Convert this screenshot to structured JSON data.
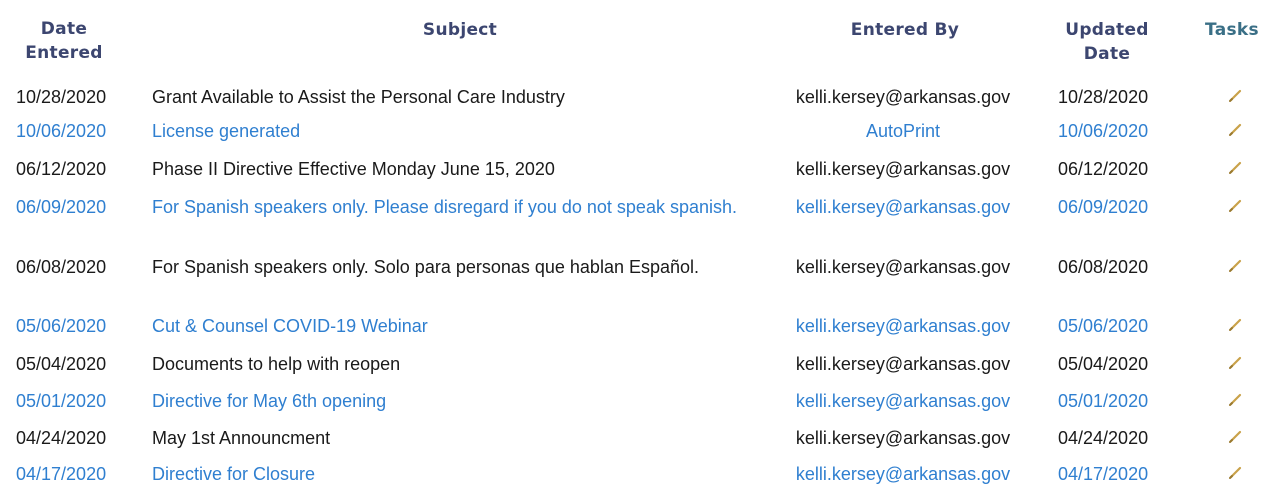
{
  "headers": {
    "date_entered_line1": "Date",
    "date_entered_line2": "Entered",
    "subject": "Subject",
    "entered_by": "Entered By",
    "updated_date_line1": "Updated",
    "updated_date_line2": "Date",
    "tasks": "Tasks"
  },
  "colors": {
    "header": "#3c4670",
    "link": "#2f7fd0",
    "text": "#1a1a1a",
    "task_icon": "#c9a24a"
  },
  "rows": [
    {
      "date_entered": "10/28/2020",
      "subject": "Grant Available to Assist the Personal Care Industry",
      "entered_by": "kelli.kersey@arkansas.gov",
      "updated_date": "10/28/2020",
      "task_icon": "pencil-icon"
    },
    {
      "date_entered": "10/06/2020",
      "subject": "License generated",
      "entered_by": "AutoPrint",
      "updated_date": "10/06/2020",
      "task_icon": "pencil-icon"
    },
    {
      "date_entered": "06/12/2020",
      "subject": "Phase II Directive Effective Monday June 15, 2020",
      "entered_by": "kelli.kersey@arkansas.gov",
      "updated_date": "06/12/2020",
      "task_icon": "pencil-icon"
    },
    {
      "date_entered": "06/09/2020",
      "subject": "For Spanish speakers only. Please disregard if you do not speak spanish.",
      "entered_by": "kelli.kersey@arkansas.gov",
      "updated_date": "06/09/2020",
      "task_icon": "pencil-icon"
    },
    {
      "date_entered": "06/08/2020",
      "subject": "For Spanish speakers only. Solo para personas que hablan Español.",
      "entered_by": "kelli.kersey@arkansas.gov",
      "updated_date": "06/08/2020",
      "task_icon": "pencil-icon"
    },
    {
      "date_entered": "05/06/2020",
      "subject": "Cut & Counsel COVID-19 Webinar",
      "entered_by": "kelli.kersey@arkansas.gov",
      "updated_date": "05/06/2020",
      "task_icon": "pencil-icon"
    },
    {
      "date_entered": "05/04/2020",
      "subject": "Documents to help with reopen",
      "entered_by": "kelli.kersey@arkansas.gov",
      "updated_date": "05/04/2020",
      "task_icon": "pencil-icon"
    },
    {
      "date_entered": "05/01/2020",
      "subject": "Directive for May 6th opening",
      "entered_by": "kelli.kersey@arkansas.gov",
      "updated_date": "05/01/2020",
      "task_icon": "pencil-icon"
    },
    {
      "date_entered": "04/24/2020",
      "subject": "May 1st Announcment",
      "entered_by": "kelli.kersey@arkansas.gov",
      "updated_date": "04/24/2020",
      "task_icon": "pencil-icon"
    },
    {
      "date_entered": "04/17/2020",
      "subject": "Directive for Closure",
      "entered_by": "kelli.kersey@arkansas.gov",
      "updated_date": "04/17/2020",
      "task_icon": "pencil-icon"
    }
  ]
}
